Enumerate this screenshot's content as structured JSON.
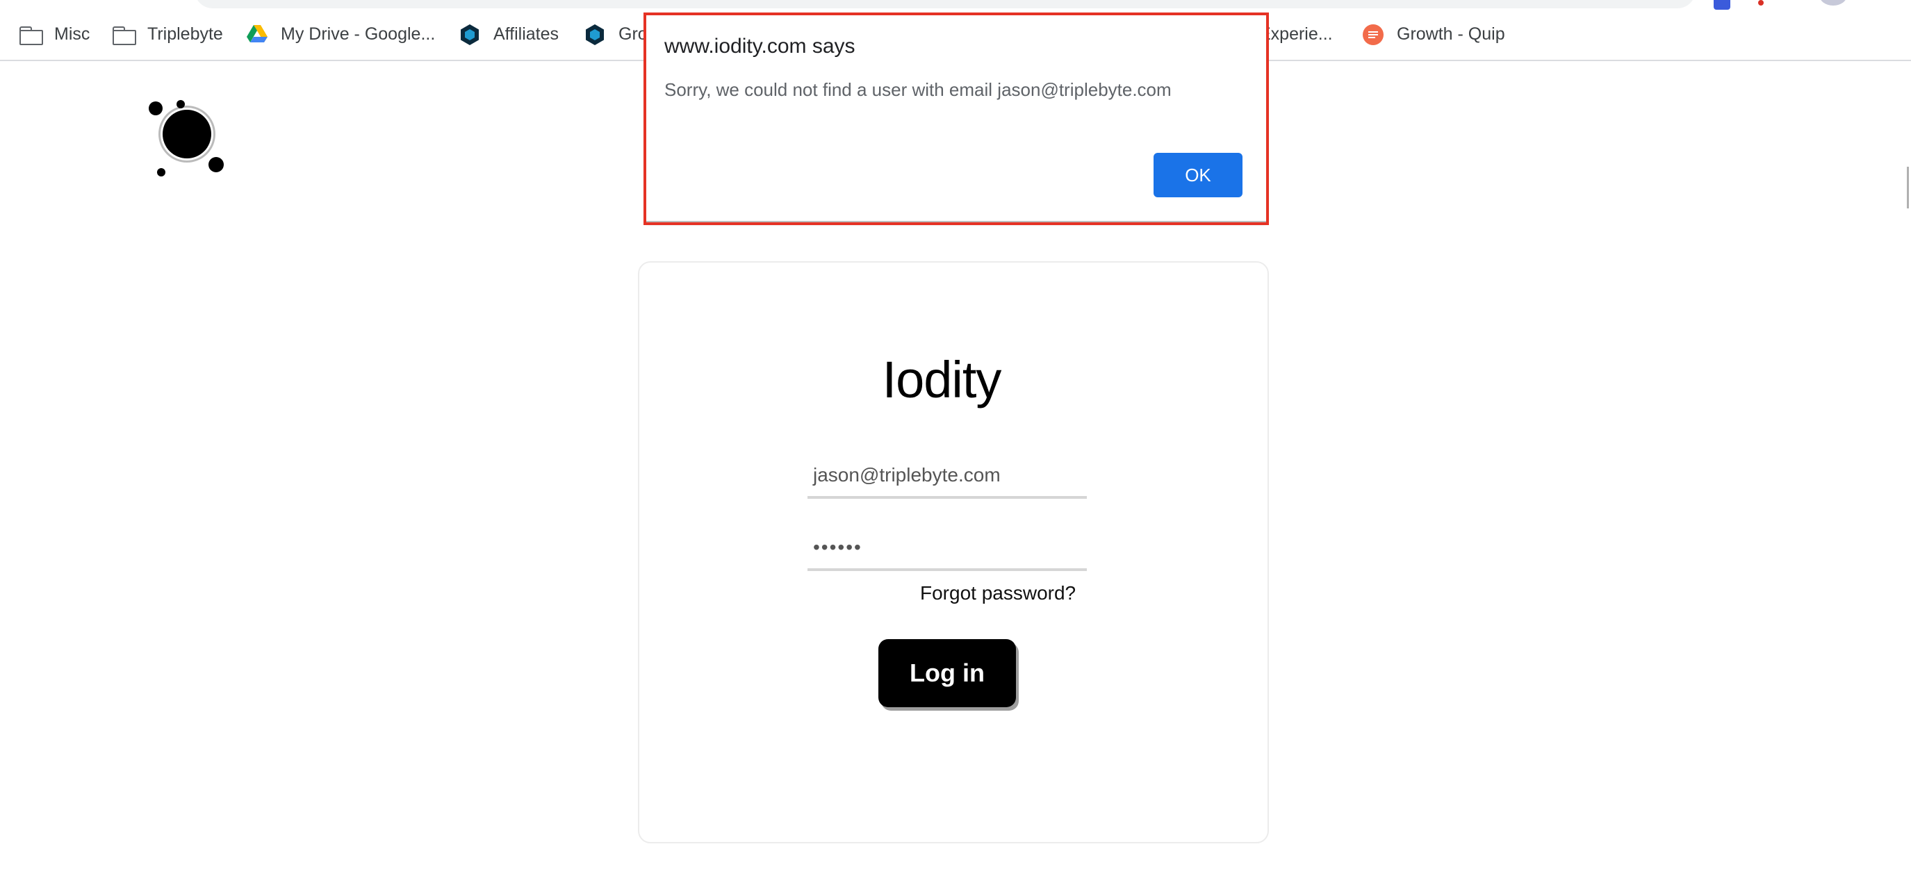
{
  "browser": {
    "bookmarks": [
      {
        "label": "Misc",
        "icon": "folder-icon"
      },
      {
        "label": "Triplebyte",
        "icon": "folder-icon"
      },
      {
        "label": "My Drive - Google...",
        "icon": "google-drive-icon"
      },
      {
        "label": "Affiliates",
        "icon": "hexagon-icon"
      },
      {
        "label": "Gro",
        "icon": "hexagon-icon"
      },
      {
        "label": "Experie...",
        "icon": ""
      },
      {
        "label": "Growth - Quip",
        "icon": "quip-icon"
      }
    ]
  },
  "dialog": {
    "title": "www.iodity.com says",
    "message": "Sorry, we could not find a user with email jason@triplebyte.com",
    "ok_label": "OK",
    "highlight_color": "#e53224",
    "button_color": "#1a73e8"
  },
  "login": {
    "brand": "Iodity",
    "email_value": "jason@triplebyte.com",
    "password_mask": "••••••",
    "forgot_label": "Forgot password?",
    "login_label": "Log in"
  }
}
